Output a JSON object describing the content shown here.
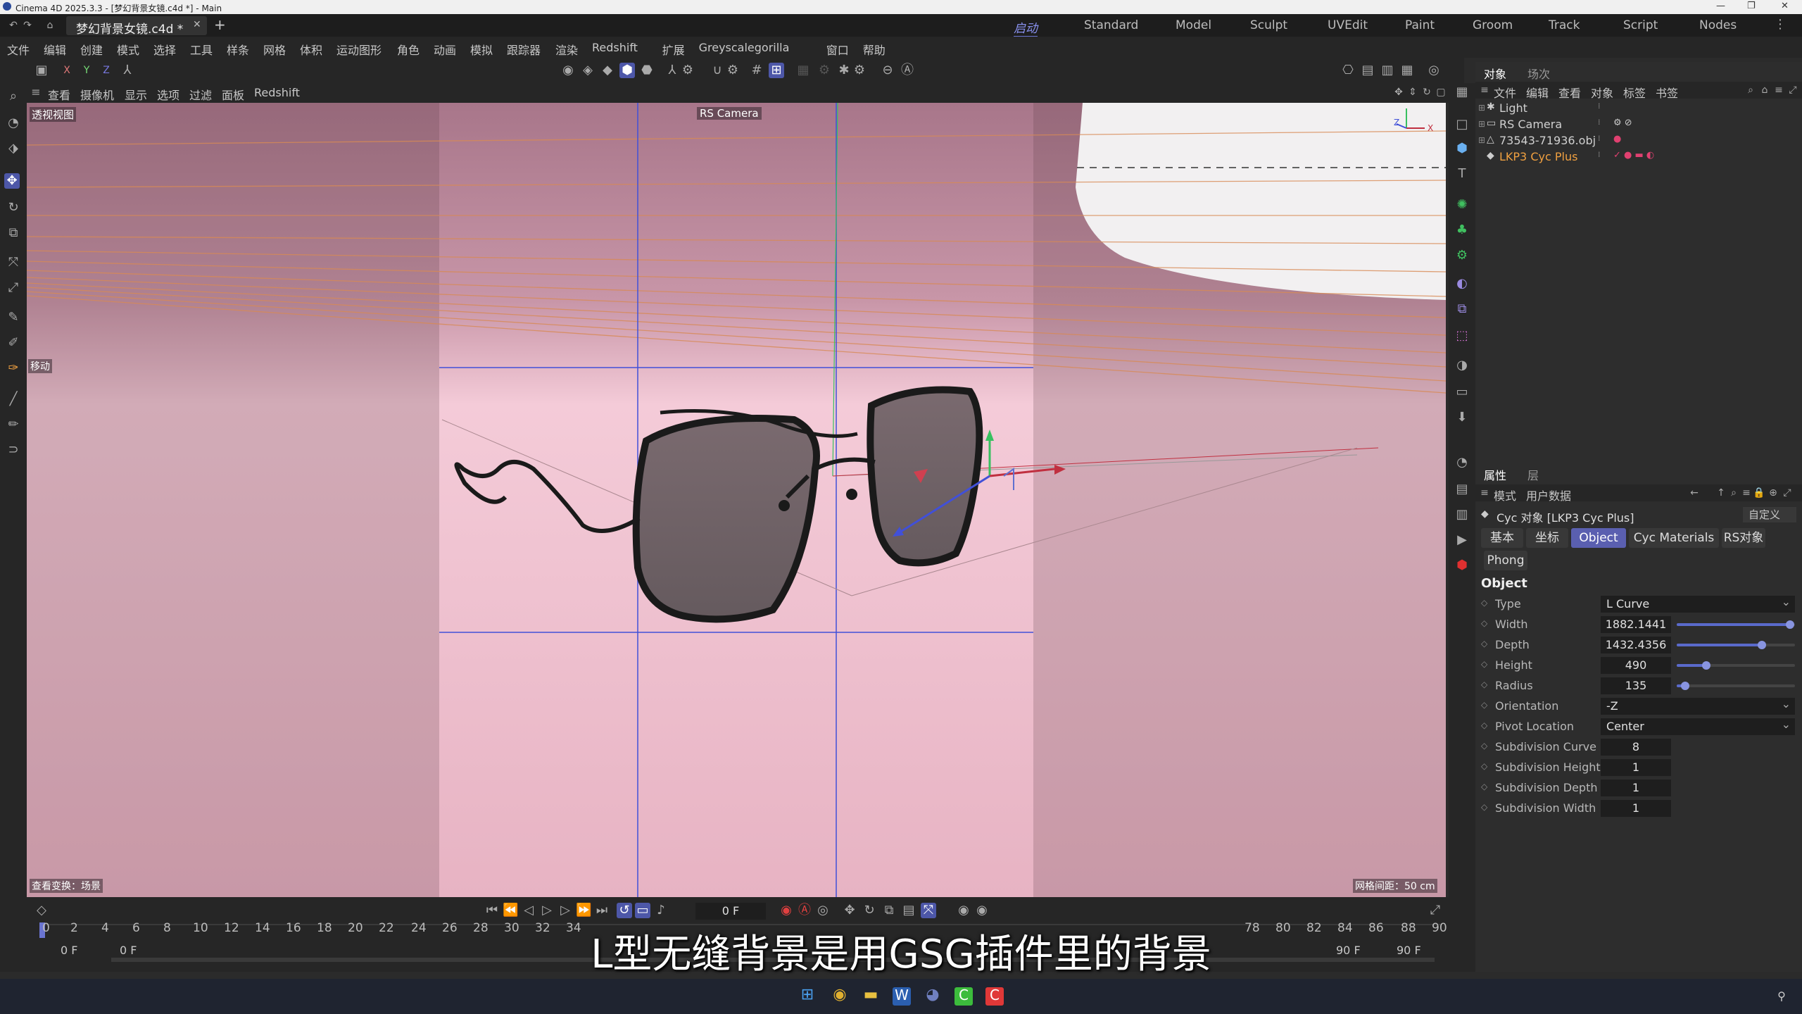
{
  "window": {
    "title": "Cinema 4D 2025.3.3 - [梦幻背景女镜.c4d *] - Main"
  },
  "tabs": {
    "doc": "梦幻背景女镜.c4d *",
    "layouts": [
      "启动",
      "Standard",
      "Model",
      "Sculpt",
      "UVEdit",
      "Paint",
      "Groom",
      "Track",
      "Script",
      "Nodes"
    ]
  },
  "menu": [
    "文件",
    "编辑",
    "创建",
    "模式",
    "选择",
    "工具",
    "样条",
    "网格",
    "体积",
    "运动图形",
    "角色",
    "动画",
    "模拟",
    "跟踪器",
    "渲染",
    "Redshift",
    "扩展",
    "Greyscalegorilla",
    "窗口",
    "帮助"
  ],
  "viewport_menu": [
    "查看",
    "摄像机",
    "显示",
    "选项",
    "过滤",
    "面板",
    "Redshift"
  ],
  "viewport": {
    "label": "透视视图",
    "camera": "RS Camera",
    "move_label": "移动",
    "bottom_left": "查看变换：场景",
    "grid": "网格间距：50 cm"
  },
  "objects": {
    "tabs": [
      "对象",
      "场次"
    ],
    "menu": [
      "文件",
      "编辑",
      "查看",
      "对象",
      "标签",
      "书签"
    ],
    "items": [
      {
        "name": "Light"
      },
      {
        "name": "RS Camera"
      },
      {
        "name": "73543-71936.obj"
      },
      {
        "name": "LKP3 Cyc Plus"
      }
    ]
  },
  "attributes": {
    "tabs": [
      "属性",
      "层"
    ],
    "menu": [
      "模式",
      "用户数据"
    ],
    "object_title": "Cyc 对象 [LKP3 Cyc Plus]",
    "preset": "自定义",
    "buttons": [
      "基本",
      "坐标",
      "Object",
      "Cyc Materials",
      "RS对象"
    ],
    "button2": "Phong",
    "section": "Object",
    "params": [
      {
        "label": "Type",
        "value": "L Curve",
        "kind": "dropdown"
      },
      {
        "label": "Width",
        "value": "1882.1441",
        "kind": "slider",
        "level": 0.96
      },
      {
        "label": "Depth",
        "value": "1432.4356",
        "kind": "slider",
        "level": 0.72
      },
      {
        "label": "Height",
        "value": "490",
        "kind": "slider",
        "level": 0.25
      },
      {
        "label": "Radius",
        "value": "135",
        "kind": "slider",
        "level": 0.07
      },
      {
        "label": "Orientation",
        "value": "-Z",
        "kind": "dropdown"
      },
      {
        "label": "Pivot Location",
        "value": "Center",
        "kind": "dropdown"
      },
      {
        "label": "Subdivision Curve",
        "value": "8",
        "kind": "field"
      },
      {
        "label": "Subdivision Height",
        "value": "1",
        "kind": "field"
      },
      {
        "label": "Subdivision Depth",
        "value": "1",
        "kind": "field"
      },
      {
        "label": "Subdivision Width",
        "value": "1",
        "kind": "field"
      }
    ]
  },
  "timeline": {
    "current": "0 F",
    "start": "0 F",
    "start2": "0 F",
    "end": "90 F",
    "end2": "90 F",
    "ticks": [
      "0",
      "2",
      "4",
      "6",
      "8",
      "10",
      "12",
      "14",
      "16",
      "18",
      "20",
      "22",
      "24",
      "26",
      "28",
      "30",
      "32",
      "34",
      "78",
      "80",
      "82",
      "84",
      "86",
      "88",
      "90"
    ]
  },
  "subtitle": "L型无缝背景是用GSG插件里的背景",
  "colors": {
    "accent": "#5a5fb0",
    "selected_object": "#f0a040"
  }
}
